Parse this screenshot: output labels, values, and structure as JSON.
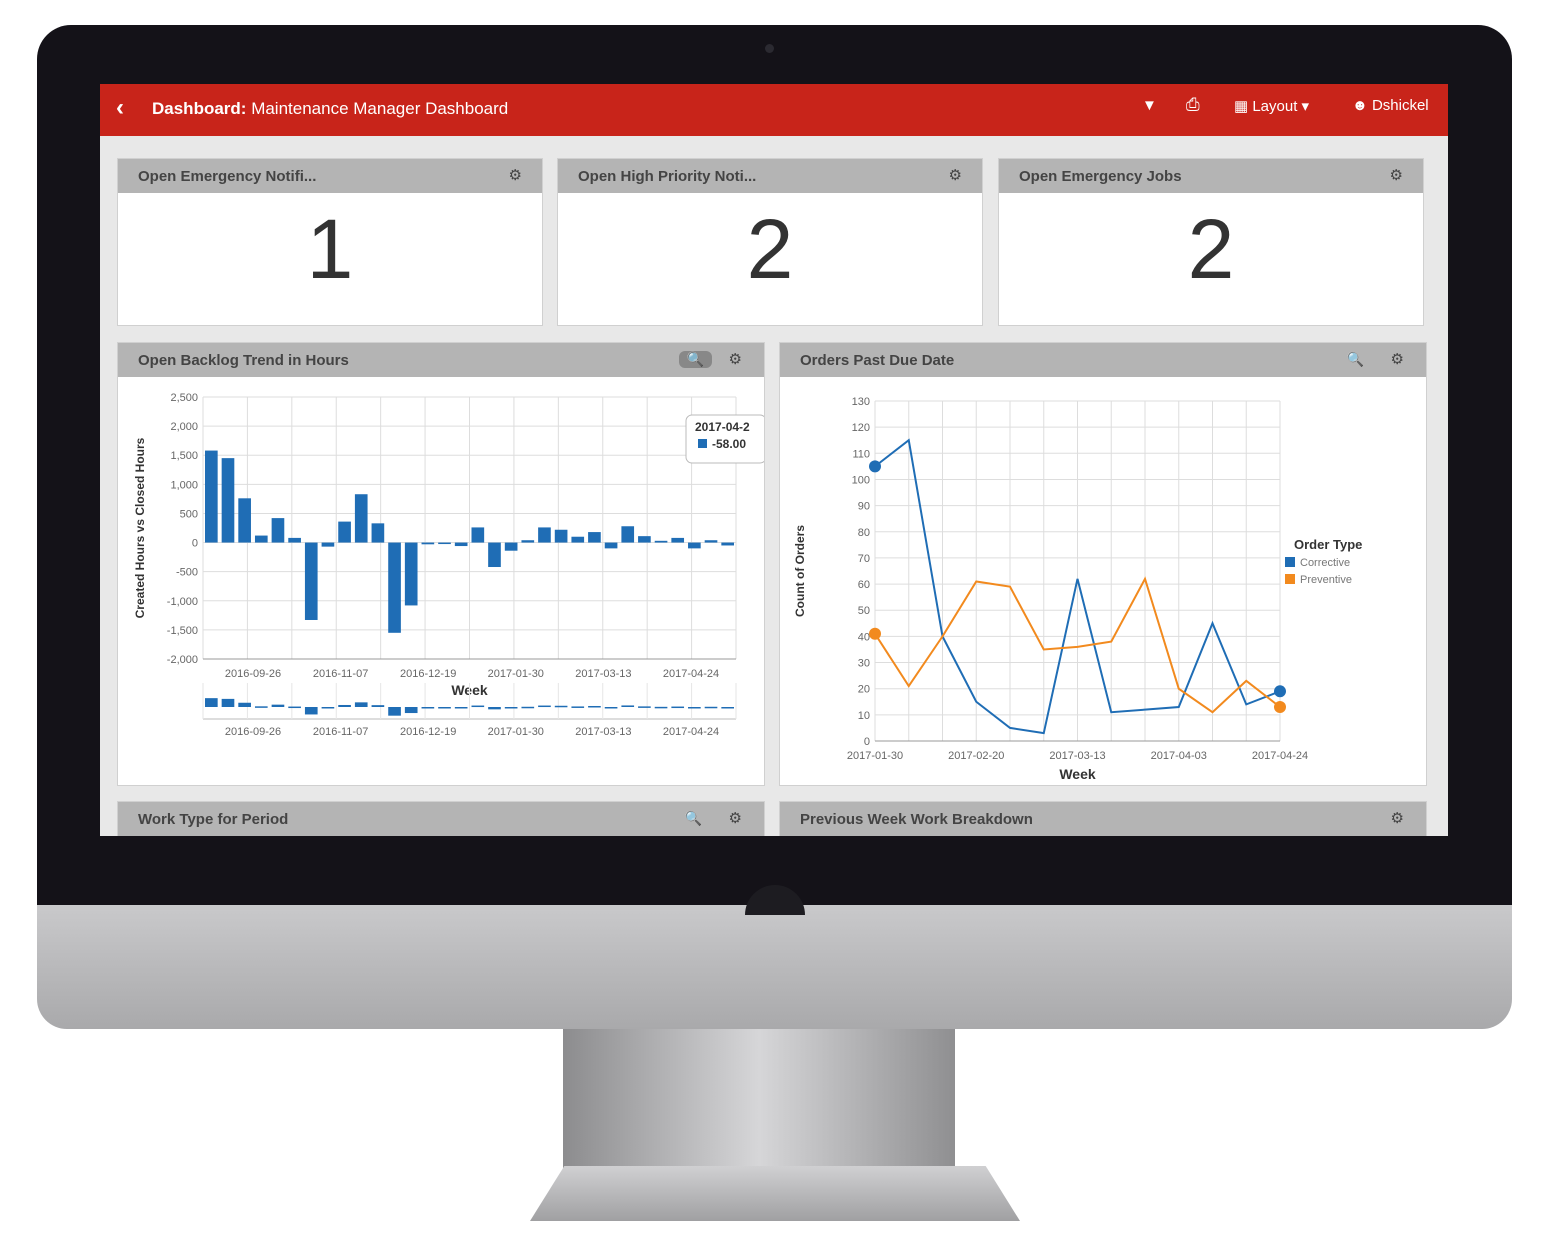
{
  "topbar": {
    "back_icon": "‹",
    "title_bold": "Dashboard:",
    "title_rest": " Maintenance Manager Dashboard",
    "filter_icon": "▼",
    "print_icon": "⎙",
    "layout_label": "Layout ▾",
    "user_label": "Dshickel",
    "accent": "#c8241a"
  },
  "kpis": [
    {
      "title": "Open Emergency Notifi...",
      "value": "1"
    },
    {
      "title": "Open High Priority Noti...",
      "value": "2"
    },
    {
      "title": "Open Emergency Jobs",
      "value": "2"
    }
  ],
  "panels": {
    "backlog_title": "Open Backlog Trend in Hours",
    "orders_title": "Orders Past Due Date",
    "worktype_title": "Work Type for Period",
    "breakdown_title": "Previous Week Work Breakdown",
    "gear_icon": "⚙",
    "zoom_icon": "🔍"
  },
  "chart_data": [
    {
      "type": "bar",
      "title": "Open Backlog Trend in Hours",
      "xlabel": "Week",
      "ylabel": "Created Hours vs Closed Hours",
      "ylim": [
        -2000,
        2500
      ],
      "yticks": [
        "2,500",
        "2,000",
        "1,500",
        "1,000",
        "500",
        "0",
        "-500",
        "-1,000",
        "-1,500",
        "-2,000"
      ],
      "xtick_labels": [
        "2016-09-26",
        "2016-11-07",
        "2016-12-19",
        "2017-01-30",
        "2017-03-13",
        "2017-04-24"
      ],
      "values": [
        1580,
        1450,
        760,
        120,
        420,
        80,
        -1330,
        -70,
        360,
        830,
        330,
        -1550,
        -1080,
        -30,
        0,
        -60,
        260,
        -420,
        -140,
        40,
        260,
        220,
        100,
        180,
        -100,
        280,
        110,
        30,
        80,
        -100,
        40,
        -50
      ],
      "tooltip": {
        "label": "2017-04-2",
        "value": "-58.00"
      },
      "color": "#1f6db5"
    },
    {
      "type": "line",
      "title": "Orders Past Due Date",
      "xlabel": "Week",
      "ylabel": "Count of Orders",
      "ylim": [
        0,
        130
      ],
      "yticks": [
        "130",
        "120",
        "110",
        "100",
        "90",
        "80",
        "70",
        "60",
        "50",
        "40",
        "30",
        "20",
        "10",
        "0"
      ],
      "xtick_labels": [
        "2017-01-30",
        "2017-02-20",
        "2017-03-13",
        "2017-04-03",
        "2017-04-24"
      ],
      "legend_title": "Order Type",
      "series": [
        {
          "name": "Corrective",
          "color": "#1f6db5",
          "values": [
            105,
            115,
            40,
            15,
            5,
            3,
            62,
            11,
            12,
            13,
            45,
            14,
            19
          ]
        },
        {
          "name": "Preventive",
          "color": "#f28a1e",
          "values": [
            41,
            21,
            40,
            61,
            59,
            35,
            36,
            38,
            62,
            20,
            11,
            23,
            13
          ]
        }
      ]
    }
  ]
}
